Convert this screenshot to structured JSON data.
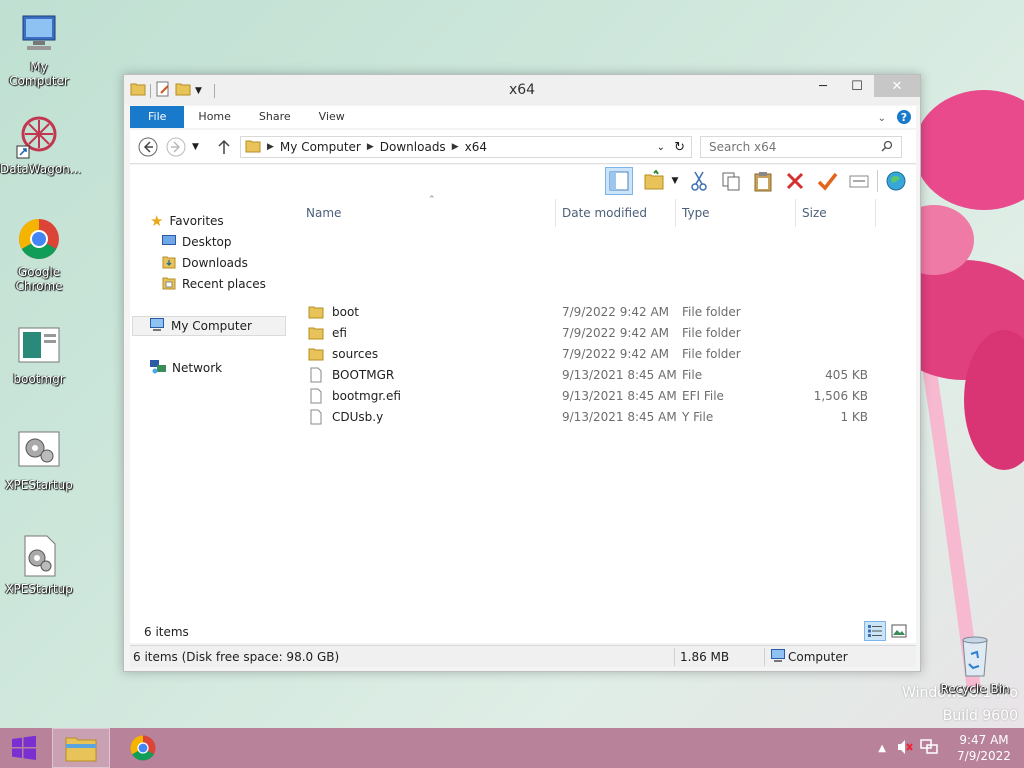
{
  "desktop": {
    "icons": [
      {
        "label": "My Computer"
      },
      {
        "label": "DataWagon..."
      },
      {
        "label": "Google Chrome"
      },
      {
        "label": "bootmgr"
      },
      {
        "label": "XPEStartup"
      },
      {
        "label": "XPEStartup"
      },
      {
        "label": "Recycle Bin"
      }
    ],
    "watermark_line1": "Windows 8.1 Pro",
    "watermark_line2": "Build 9600"
  },
  "window": {
    "title": "x64",
    "ribbon_tabs": [
      "File",
      "Home",
      "Share",
      "View"
    ],
    "breadcrumb": [
      "My Computer",
      "Downloads",
      "x64"
    ],
    "search_placeholder": "Search x64",
    "nav": {
      "favorites": "Favorites",
      "desktop": "Desktop",
      "downloads": "Downloads",
      "recent": "Recent places",
      "my_computer": "My Computer",
      "network": "Network"
    },
    "columns": [
      "Name",
      "Date modified",
      "Type",
      "Size"
    ],
    "files": [
      {
        "name": "boot",
        "date": "7/9/2022 9:42 AM",
        "type": "File folder",
        "size": "",
        "kind": "folder"
      },
      {
        "name": "efi",
        "date": "7/9/2022 9:42 AM",
        "type": "File folder",
        "size": "",
        "kind": "folder"
      },
      {
        "name": "sources",
        "date": "7/9/2022 9:42 AM",
        "type": "File folder",
        "size": "",
        "kind": "folder"
      },
      {
        "name": "BOOTMGR",
        "date": "9/13/2021 8:45 AM",
        "type": "File",
        "size": "405 KB",
        "kind": "file"
      },
      {
        "name": "bootmgr.efi",
        "date": "9/13/2021 8:45 AM",
        "type": "EFI File",
        "size": "1,506 KB",
        "kind": "file"
      },
      {
        "name": "CDUsb.y",
        "date": "9/13/2021 8:45 AM",
        "type": "Y File",
        "size": "1 KB",
        "kind": "file"
      }
    ],
    "item_count": "6 items",
    "status": {
      "disk": "6 items (Disk free space: 98.0 GB)",
      "size": "1.86 MB",
      "location": "Computer"
    }
  },
  "taskbar": {
    "time": "9:47 AM",
    "date": "7/9/2022"
  },
  "colors": {
    "accent": "#1979ca",
    "taskbar": "#b7829a",
    "folder": "#e8c35a"
  }
}
